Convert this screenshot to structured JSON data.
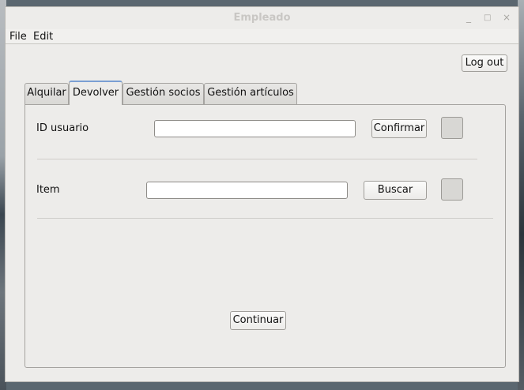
{
  "window": {
    "title": "Empleado",
    "controls": {
      "minimize": "_",
      "maximize": "□",
      "close": "×"
    }
  },
  "menu": {
    "file": "File",
    "edit": "Edit"
  },
  "header": {
    "logout_label": "Log out"
  },
  "tabs": [
    {
      "label": "Alquilar",
      "active": false
    },
    {
      "label": "Devolver",
      "active": true
    },
    {
      "label": "Gestión socios",
      "active": false
    },
    {
      "label": "Gestión artículos",
      "active": false
    }
  ],
  "devolver": {
    "user_label": "ID usuario",
    "user_value": "",
    "confirm_label": "Confirmar",
    "item_label": "Item",
    "item_value": "",
    "search_label": "Buscar",
    "continue_label": "Continuar"
  },
  "colors": {
    "window_bg": "#edecea",
    "active_tab_accent": "#7a9fd3",
    "indicator_bg": "#d8d7d4"
  }
}
